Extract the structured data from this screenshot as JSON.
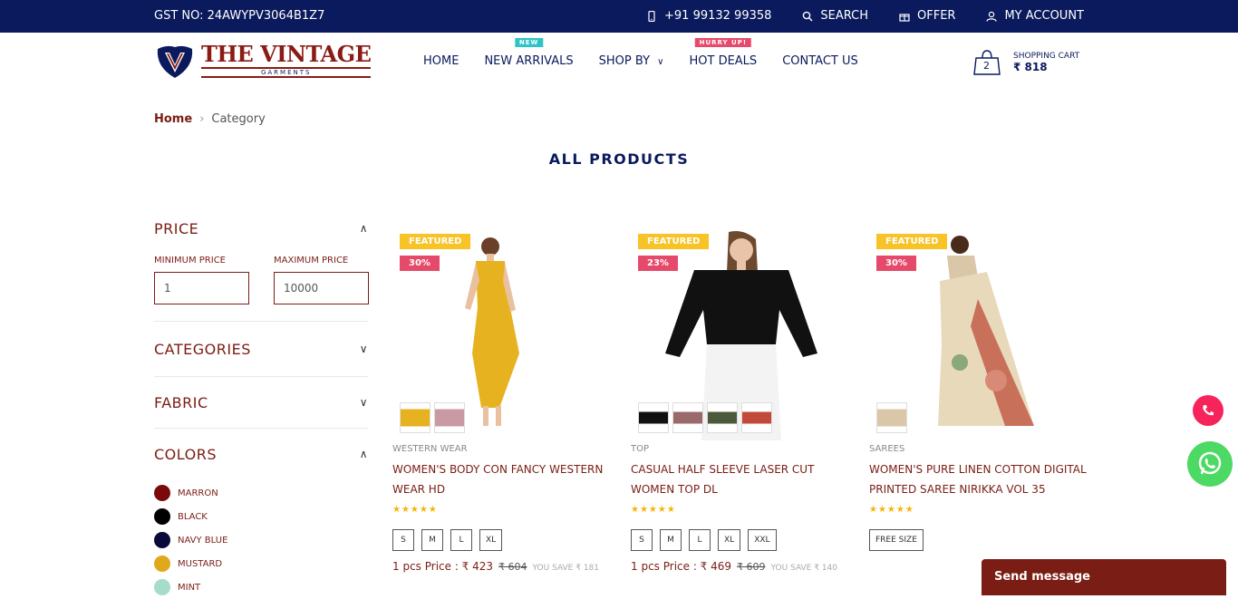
{
  "topbar": {
    "gst": "GST NO: 24AWYPV3064B1Z7",
    "phone": "+91 99132 99358",
    "search": "SEARCH",
    "offer": "OFFER",
    "account": "MY ACCOUNT"
  },
  "logo": {
    "title": "THE VINTAGE",
    "subtitle": "GARMENTS"
  },
  "nav": [
    {
      "label": "HOME",
      "tag": ""
    },
    {
      "label": "NEW ARRIVALS",
      "tag": "NEW"
    },
    {
      "label": "SHOP BY",
      "tag": ""
    },
    {
      "label": "HOT DEALS",
      "tag": "HURRY UP!"
    },
    {
      "label": "CONTACT US",
      "tag": ""
    }
  ],
  "cart": {
    "count": "2",
    "label": "SHOPPING CART",
    "amount": "₹ 818"
  },
  "breadcrumb": {
    "home": "Home",
    "current": "Category"
  },
  "page_title": "ALL PRODUCTS",
  "filters": {
    "price": {
      "title": "PRICE",
      "min_label": "MINIMUM PRICE",
      "max_label": "MAXIMUM PRICE",
      "min_value": "1",
      "max_value": "10000"
    },
    "categories": "CATEGORIES",
    "fabric": "FABRIC",
    "colors": {
      "title": "COLORS",
      "items": [
        {
          "name": "MARRON",
          "hex": "#7a0a0a"
        },
        {
          "name": "BLACK",
          "hex": "#000000"
        },
        {
          "name": "NAVY BLUE",
          "hex": "#0a0a3a"
        },
        {
          "name": "MUSTARD",
          "hex": "#e0a91b"
        },
        {
          "name": "MINT",
          "hex": "#a6dccc"
        }
      ]
    }
  },
  "products": [
    {
      "featured": "FEATURED",
      "discount": "30%",
      "category": "WESTERN WEAR",
      "name": "WOMEN'S BODY CON FANCY WESTERN WEAR HD",
      "stars": "★★★★★",
      "sizes": [
        "S",
        "M",
        "L",
        "XL"
      ],
      "price_label": "1 pcs Price : ₹ 423",
      "old_price": "₹ 604",
      "save": "YOU SAVE ₹ 181"
    },
    {
      "featured": "FEATURED",
      "discount": "23%",
      "category": "TOP",
      "name": "CASUAL HALF SLEEVE LASER CUT WOMEN TOP DL",
      "stars": "★★★★★",
      "sizes": [
        "S",
        "M",
        "L",
        "XL",
        "XXL"
      ],
      "price_label": "1 pcs Price : ₹ 469",
      "old_price": "₹ 609",
      "save": "YOU SAVE ₹ 140"
    },
    {
      "featured": "FEATURED",
      "discount": "30%",
      "category": "SAREES",
      "name": "WOMEN'S PURE LINEN COTTON DIGITAL PRINTED SAREE NIRIKKA VOL 35",
      "stars": "★★★★★",
      "sizes": [
        "FREE SIZE"
      ],
      "price_label": "",
      "old_price": "",
      "save": ""
    }
  ],
  "chat": {
    "send_message": "Send message"
  },
  "colors": {
    "navy": "#0a1a5c",
    "maroon": "#7a1d14",
    "featured": "#f7c327",
    "discount": "#e64a6a"
  }
}
